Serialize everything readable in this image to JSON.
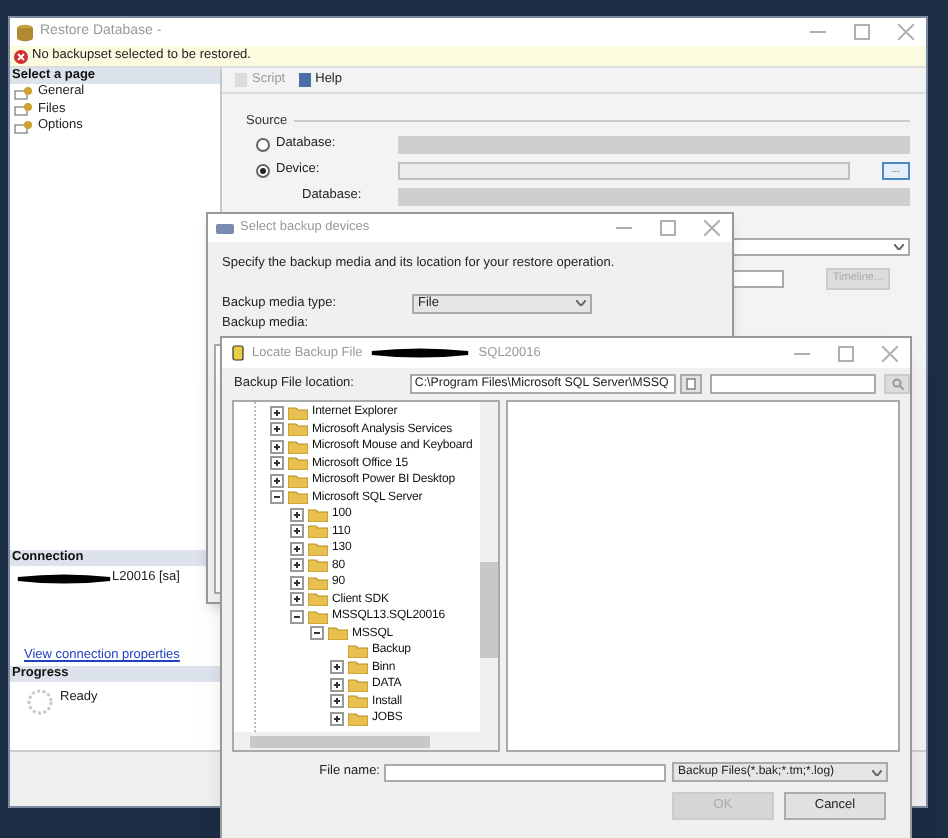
{
  "restore_window": {
    "title": "Restore Database -",
    "error": "No backupset selected to be restored.",
    "select_page": {
      "header": "Select a page",
      "items": [
        "General",
        "Files",
        "Options"
      ]
    },
    "toolbar": [
      "Script",
      "Help"
    ],
    "source": {
      "label": "Source",
      "options": [
        {
          "label": "Database:",
          "selected": false
        },
        {
          "label": "Device:",
          "selected": true
        }
      ],
      "browse_button": "...",
      "database_label": "Database:"
    },
    "timeline_button": {
      "label": "Timeline...",
      "disabled": true
    },
    "connection": {
      "header": "Connection",
      "server": "L20016 [sa]",
      "link": "View connection properties"
    },
    "progress": {
      "header": "Progress",
      "status": "Ready"
    }
  },
  "devices_window": {
    "title": "Select backup devices",
    "instruction": "Specify the backup media and its location for your restore operation.",
    "media_type_label": "Backup media type:",
    "media_type": "File",
    "media_label": "Backup media:"
  },
  "locate_window": {
    "title": "Locate Backup File",
    "title_suffix": "SQL20016",
    "location_label": "Backup File location:",
    "location": "C:\\Program Files\\Microsoft SQL Server\\MSSQ",
    "tree": [
      {
        "label": "Internet Explorer",
        "expandable": true,
        "expanded": false
      },
      {
        "label": "Microsoft Analysis Services",
        "expandable": true,
        "expanded": false
      },
      {
        "label": "Microsoft Mouse and Keyboard",
        "expandable": true,
        "expanded": false
      },
      {
        "label": "Microsoft Office 15",
        "expandable": true,
        "expanded": false
      },
      {
        "label": "Microsoft Power BI Desktop",
        "expandable": true,
        "expanded": false
      },
      {
        "label": "Microsoft SQL Server",
        "expandable": true,
        "expanded": true,
        "children": [
          {
            "label": "100",
            "expandable": true,
            "expanded": false
          },
          {
            "label": "110",
            "expandable": true,
            "expanded": false
          },
          {
            "label": "130",
            "expandable": true,
            "expanded": false
          },
          {
            "label": "80",
            "expandable": true,
            "expanded": false
          },
          {
            "label": "90",
            "expandable": true,
            "expanded": false
          },
          {
            "label": "Client SDK",
            "expandable": true,
            "expanded": false
          },
          {
            "label": "MSSQL13.SQL20016",
            "expandable": true,
            "expanded": true,
            "children": [
              {
                "label": "MSSQL",
                "expandable": true,
                "expanded": true,
                "children": [
                  {
                    "label": "Backup",
                    "expandable": false,
                    "expanded": false
                  },
                  {
                    "label": "Binn",
                    "expandable": true,
                    "expanded": false
                  },
                  {
                    "label": "DATA",
                    "expandable": true,
                    "expanded": false
                  },
                  {
                    "label": "Install",
                    "expandable": true,
                    "expanded": false
                  },
                  {
                    "label": "JOBS",
                    "expandable": true,
                    "expanded": false
                  }
                ]
              }
            ]
          }
        ]
      }
    ],
    "file_name_label": "File name:",
    "file_type": "Backup Files(*.bak;*.tm;*.log)",
    "buttons": [
      {
        "label": "OK",
        "disabled": true
      },
      {
        "label": "Cancel",
        "disabled": false
      }
    ]
  }
}
